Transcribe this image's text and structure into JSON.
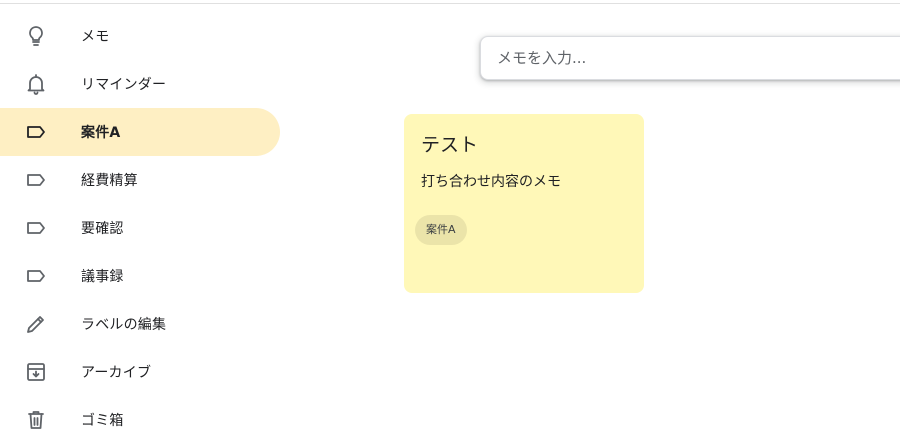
{
  "sidebar": {
    "items": [
      {
        "label": "メモ",
        "icon": "lightbulb-icon",
        "active": false
      },
      {
        "label": "リマインダー",
        "icon": "bell-icon",
        "active": false
      },
      {
        "label": "案件A",
        "icon": "label-icon",
        "active": true
      },
      {
        "label": "経費精算",
        "icon": "label-icon",
        "active": false
      },
      {
        "label": "要確認",
        "icon": "label-icon",
        "active": false
      },
      {
        "label": "議事録",
        "icon": "label-icon",
        "active": false
      },
      {
        "label": "ラベルの編集",
        "icon": "pencil-icon",
        "active": false
      },
      {
        "label": "アーカイブ",
        "icon": "archive-icon",
        "active": false
      },
      {
        "label": "ゴミ箱",
        "icon": "trash-icon",
        "active": false
      }
    ]
  },
  "new_note": {
    "placeholder": "メモを入力..."
  },
  "notes": [
    {
      "title": "テスト",
      "body": "打ち合わせ内容のメモ",
      "label_chip": "案件A",
      "color": "#fff8b8"
    }
  ],
  "colors": {
    "active_nav_bg": "#feefc3",
    "note_yellow": "#fff8b8"
  }
}
